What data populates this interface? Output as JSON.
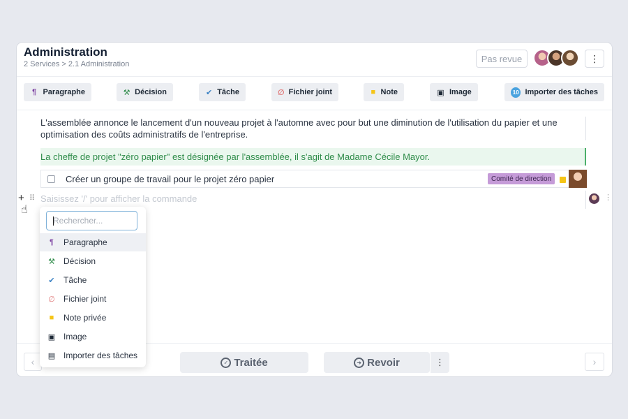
{
  "header": {
    "title": "Administration",
    "breadcrumb": "2 Services > 2.1 Administration",
    "status": "Pas revue",
    "more": "⋮"
  },
  "toolbar": {
    "items": [
      {
        "label": "Paragraphe",
        "icon": "pilcrow-icon",
        "glyph": "¶",
        "color": "#7b3fa0"
      },
      {
        "label": "Décision",
        "icon": "gavel-icon",
        "glyph": "⚒",
        "color": "#2f8c4a"
      },
      {
        "label": "Tâche",
        "icon": "check-icon",
        "glyph": "✔",
        "color": "#3b82c4"
      },
      {
        "label": "Fichier joint",
        "icon": "paperclip-icon",
        "glyph": "∅",
        "color": "#e07a7a"
      },
      {
        "label": "Note",
        "icon": "note-icon",
        "glyph": "■",
        "color": "#f5c518"
      },
      {
        "label": "Image",
        "icon": "image-icon",
        "glyph": "▣",
        "color": "#1f2a37"
      },
      {
        "label": "Importer des tâches",
        "icon": "count-badge-icon",
        "glyph": "10",
        "color": "#4aa3df"
      }
    ]
  },
  "content": {
    "paragraph": "L'assemblée annonce le lancement d'un nouveau projet à l'automne avec pour but une diminution de l'utilisation du papier et une optimisation des coûts administratifs de l'entreprise.",
    "decision": "La cheffe de projet \"zéro papier\" est désignée par l'assemblée, il s'agit de Madame Cécile Mayor.",
    "task": {
      "label": "Créer un groupe de travail pour le projet zéro papier",
      "tag": "Comité de direction"
    },
    "placeholder": "Saisissez '/' pour afficher la commande"
  },
  "menu": {
    "search_placeholder": "Rechercher...",
    "items": [
      {
        "label": "Paragraphe",
        "icon": "pilcrow-icon",
        "glyph": "¶",
        "color": "#7b3fa0"
      },
      {
        "label": "Décision",
        "icon": "gavel-icon",
        "glyph": "⚒",
        "color": "#2f8c4a"
      },
      {
        "label": "Tâche",
        "icon": "check-icon",
        "glyph": "✔",
        "color": "#3b82c4"
      },
      {
        "label": "Fichier joint",
        "icon": "paperclip-icon",
        "glyph": "∅",
        "color": "#e07a7a"
      },
      {
        "label": "Note privée",
        "icon": "note-icon",
        "glyph": "■",
        "color": "#f5c518"
      },
      {
        "label": "Image",
        "icon": "image-icon",
        "glyph": "▣",
        "color": "#1f2a37"
      },
      {
        "label": "Importer des tâches",
        "icon": "import-tasks-icon",
        "glyph": "▤",
        "color": "#1f2a37"
      }
    ]
  },
  "footer": {
    "done_label": "Traitée",
    "review_label": "Revoir",
    "prev": "‹",
    "next": "›",
    "more": "⋮"
  }
}
